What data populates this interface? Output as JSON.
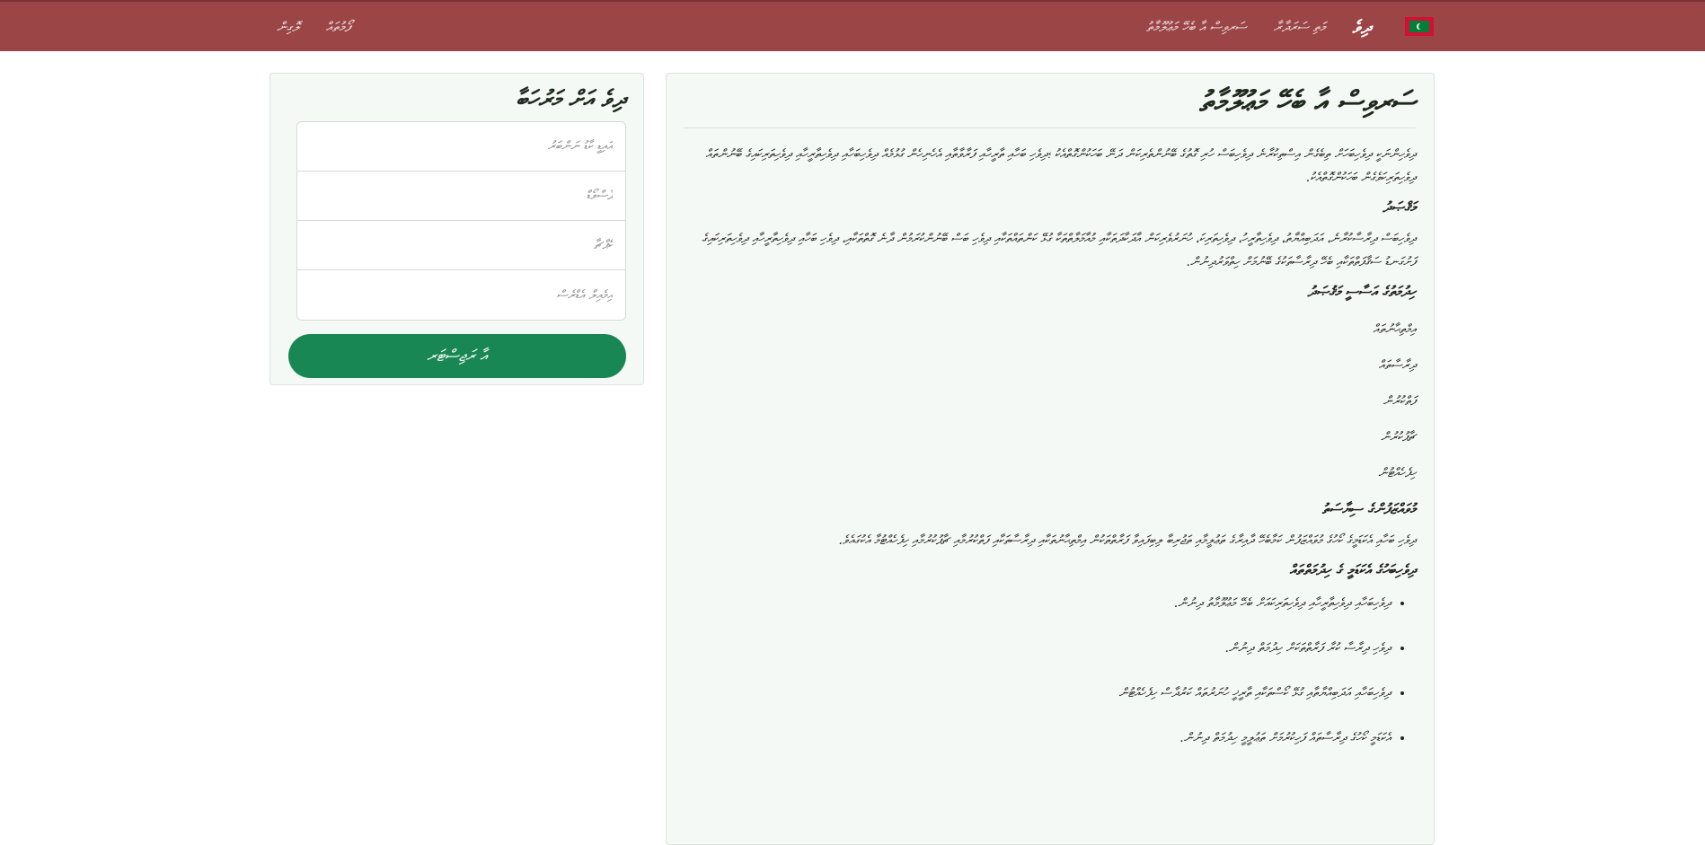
{
  "colors": {
    "navbar": "#9b4547",
    "accent_button": "#198754",
    "card_background": "#f5f9f5",
    "flag_red": "#d21034",
    "flag_green": "#007e3a"
  },
  "navbar": {
    "flag_icon": "maldives-flag-icon",
    "brand": "ދިވެ",
    "links": [
      "މަތި ސަރަދާރާ",
      "ސަރވިސް އާ ބެހޭ މަޢުލޫމާތު"
    ],
    "left_links": [
      "ފޯމުތައް",
      "ލޮގިން"
    ]
  },
  "main": {
    "title": "ސަރވިސް އާ ބެހޭ މަޢުލޫމާތު",
    "intro": "ދިވެހިންނަކީ ދިވެހިބަހަށް ތިބެގެން އިސްތިކުރާނެ ދިވެހިބަސް ހުރި ގޮތުގެ ބޭނުންތެރިކަން ދަނޭ ބަހަކުންގޮތްއެކު ؛ދިވެހި ބަހާއި ތާރީހާއި ފަރާވާތާއި އެހެނިހެން ގުޅުމެއް ދިވެހިބަހާއި ދިވެހިތާރީހާއި ދިވެހިތަރިކައިގެ ބޭނުންތައް ދިވެހިތަރިކަވެގެން ބަހަކުންގޮތްއެކު.",
    "section1_heading": "މަޤްޞަދު",
    "section1_text": "ދިވެހިބަސް ދިރާސާކުރާނެ، އަދަބިއްޔާތު، ދިވެހިތާރީހު، ދިވެހިތަރިކަ، ހުނަރުވެރިކަން އާދަކާދަތަކާއި މުއާމަލާތްތަކާ ގުޅޭ ކަންތައްތަކާއި ދިވެހި ބަސް ބޭނުންކުރަމުން ދާނެ ގޮތްތަކާއި، ދިވެހި ބަހާއި ދިވެހިތާރީހާއި ދިވެހިތަރިކައިގެ ފަށުގަނޑު ސަޤާފަތްތަކާއި ބެހޭ ދިރާސާތަކުގެ ބޭނުމަށް ހިތްވަރުދިނުން.",
    "section2_heading": "ހިދުމަތުގެ އަސާސީ މަޤުޞަދު",
    "services": [
      "އިމްތިޙާނުތައް",
      "ދިރާސާތައް",
      "ފަތްކުރުން",
      "ޗާޕުކުރުން",
      "ހިފެހެއްޓުން"
    ],
    "section3_heading": "މުވައްޒަފުންގެ ސިޔާސަތު",
    "section3_text": "ދިވެހި ބަހާއި އެކަޑަމީގެ ކޯހުގެ މުވައްޒަފުން ކަމާބެހޭ ދާއިރާގެ ތަޢުލީމާއި ތަޖުރިބާ ލިބިފައިވާ ފަރާތްތަކުން އިމްތިޙާނުތަކާއި ދިރާސާތަކާއި ފަތްކުރުމާއި ޗާޕުކުރުމާއި ހިފެހެއްޓުމާ އެކުގައެވެ.",
    "section4_heading": "ދިވެހިބަހުގެ އެކަޑަމީ ގެ ހިދުމަތްތައް",
    "bullets": [
      "ދިވެހިބަހާއި ދިވެހިތާރީހާއި ދިވެހިތަރިކައަށް ބެހޭ މަޢުލޫމާތު ދިނުން.",
      "ދިވެހި ދިރާސާ ކުރާ ފަރާތްތަކަށް ހިދުމަތް ދިނުން.",
      "ދިވެހިބަހާއި އަދަބިއްޔާތާއި ގުޅޭ ކޯސްތަކާއި ތާރީޚީ ހުނަރުތައް ކަރުދާސް ހިފެހެއްޓުން",
      "އެކަޑަމީ ކޯހުގެ ދިރާސާތައް ފަހިކުރުމަށް ތަޢުލީމީ ހިދުމަތް ދިނުން."
    ]
  },
  "login": {
    "title": "ދިވެ އަށް މަރުހަބާ",
    "fields": [
      {
        "placeholder": "އައިޑީ ކާޑު ނަންބަރު"
      },
      {
        "placeholder": "ޕާސްވޯޑް"
      },
      {
        "placeholder": "ކެޕްޗާ"
      },
      {
        "placeholder": "އިމެއިލް އެޑްރެސް"
      }
    ],
    "submit_label": "އާ ރަޖިސްޓަރ"
  }
}
